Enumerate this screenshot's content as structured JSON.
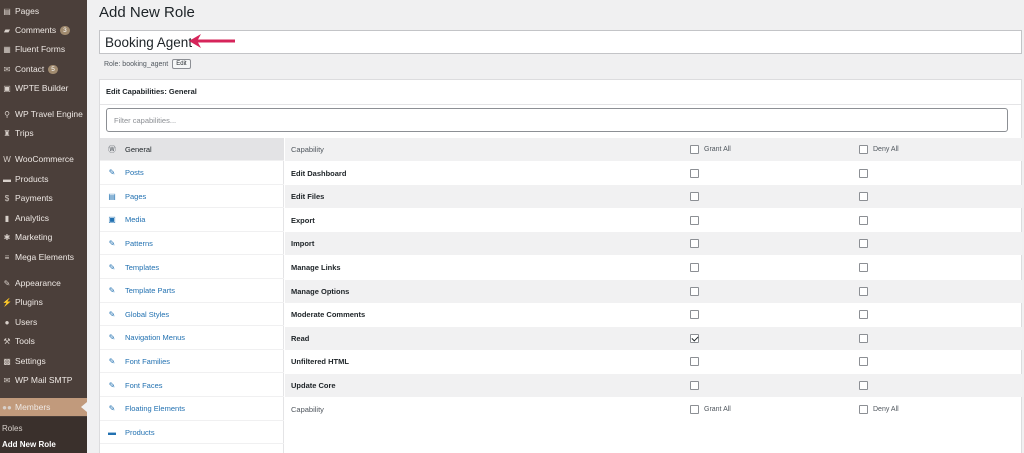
{
  "sidebar": {
    "items": [
      {
        "label": "Pages",
        "icon": "pages-icon",
        "glyph": "▤"
      },
      {
        "label": "Comments",
        "icon": "comments-icon",
        "glyph": "▰",
        "badge": "3"
      },
      {
        "label": "Fluent Forms",
        "icon": "forms-icon",
        "glyph": "▦"
      },
      {
        "label": "Contact",
        "icon": "envelope-icon",
        "glyph": "✉",
        "badge": "5"
      },
      {
        "label": "WPTE Builder",
        "icon": "builder-icon",
        "glyph": "▣"
      },
      {
        "label": "WP Travel Engine",
        "icon": "travel-icon",
        "glyph": "⚲"
      },
      {
        "label": "Trips",
        "icon": "trips-icon",
        "glyph": "♜"
      },
      {
        "label": "WooCommerce",
        "icon": "woo-icon",
        "glyph": "W"
      },
      {
        "label": "Products",
        "icon": "products-icon",
        "glyph": "▬"
      },
      {
        "label": "Payments",
        "icon": "payments-icon",
        "glyph": "$"
      },
      {
        "label": "Analytics",
        "icon": "analytics-icon",
        "glyph": "▮"
      },
      {
        "label": "Marketing",
        "icon": "marketing-icon",
        "glyph": "✱"
      },
      {
        "label": "Mega Elements",
        "icon": "mega-icon",
        "glyph": "≡"
      },
      {
        "label": "Appearance",
        "icon": "appearance-icon",
        "glyph": "✎"
      },
      {
        "label": "Plugins",
        "icon": "plugins-icon",
        "glyph": "⚡"
      },
      {
        "label": "Users",
        "icon": "users-icon",
        "glyph": "●"
      },
      {
        "label": "Tools",
        "icon": "tools-icon",
        "glyph": "⚒"
      },
      {
        "label": "Settings",
        "icon": "settings-icon",
        "glyph": "▩"
      },
      {
        "label": "WP Mail SMTP",
        "icon": "mail-icon",
        "glyph": "✉"
      },
      {
        "label": "Members",
        "icon": "members-icon",
        "glyph": "●●"
      }
    ],
    "submenu": {
      "roles": "Roles",
      "add_new_role": "Add New Role"
    }
  },
  "page": {
    "title": "Add New Role",
    "role_name_value": "Booking Agent",
    "role_label": "Role:",
    "role_slug": "booking_agent",
    "edit_label": "Edit"
  },
  "panel": {
    "title": "Edit Capabilities: General",
    "filter_placeholder": "Filter capabilities..."
  },
  "tabs": [
    {
      "label": "General",
      "icon": "wordpress-icon",
      "glyph": "Ⓦ",
      "active": true
    },
    {
      "label": "Posts",
      "icon": "pin-icon",
      "glyph": "✎"
    },
    {
      "label": "Pages",
      "icon": "pages-icon",
      "glyph": "▤"
    },
    {
      "label": "Media",
      "icon": "media-icon",
      "glyph": "▣"
    },
    {
      "label": "Patterns",
      "icon": "pin-icon",
      "glyph": "✎"
    },
    {
      "label": "Templates",
      "icon": "pin-icon",
      "glyph": "✎"
    },
    {
      "label": "Template Parts",
      "icon": "pin-icon",
      "glyph": "✎"
    },
    {
      "label": "Global Styles",
      "icon": "pin-icon",
      "glyph": "✎"
    },
    {
      "label": "Navigation Menus",
      "icon": "pin-icon",
      "glyph": "✎"
    },
    {
      "label": "Font Families",
      "icon": "pin-icon",
      "glyph": "✎"
    },
    {
      "label": "Font Faces",
      "icon": "pin-icon",
      "glyph": "✎"
    },
    {
      "label": "Floating Elements",
      "icon": "pin-icon",
      "glyph": "✎"
    },
    {
      "label": "Products",
      "icon": "products-icon",
      "glyph": "▬"
    }
  ],
  "capabilities": {
    "header": {
      "capability": "Capability",
      "grant_all": "Grant All",
      "deny_all": "Deny All"
    },
    "rows": [
      {
        "name": "Edit Dashboard",
        "grant": false,
        "deny": false
      },
      {
        "name": "Edit Files",
        "grant": false,
        "deny": false
      },
      {
        "name": "Export",
        "grant": false,
        "deny": false
      },
      {
        "name": "Import",
        "grant": false,
        "deny": false
      },
      {
        "name": "Manage Links",
        "grant": false,
        "deny": false
      },
      {
        "name": "Manage Options",
        "grant": false,
        "deny": false
      },
      {
        "name": "Moderate Comments",
        "grant": false,
        "deny": false
      },
      {
        "name": "Read",
        "grant": true,
        "deny": false
      },
      {
        "name": "Unfiltered HTML",
        "grant": false,
        "deny": false
      },
      {
        "name": "Update Core",
        "grant": false,
        "deny": false
      }
    ],
    "footer": {
      "capability": "Capability",
      "grant_all": "Grant All",
      "deny_all": "Deny All"
    }
  },
  "colors": {
    "sidebar_bg": "#4b3f3a",
    "active_menu": "#c19a7c",
    "link": "#2271b1",
    "annotation_arrow": "#d6245a"
  }
}
